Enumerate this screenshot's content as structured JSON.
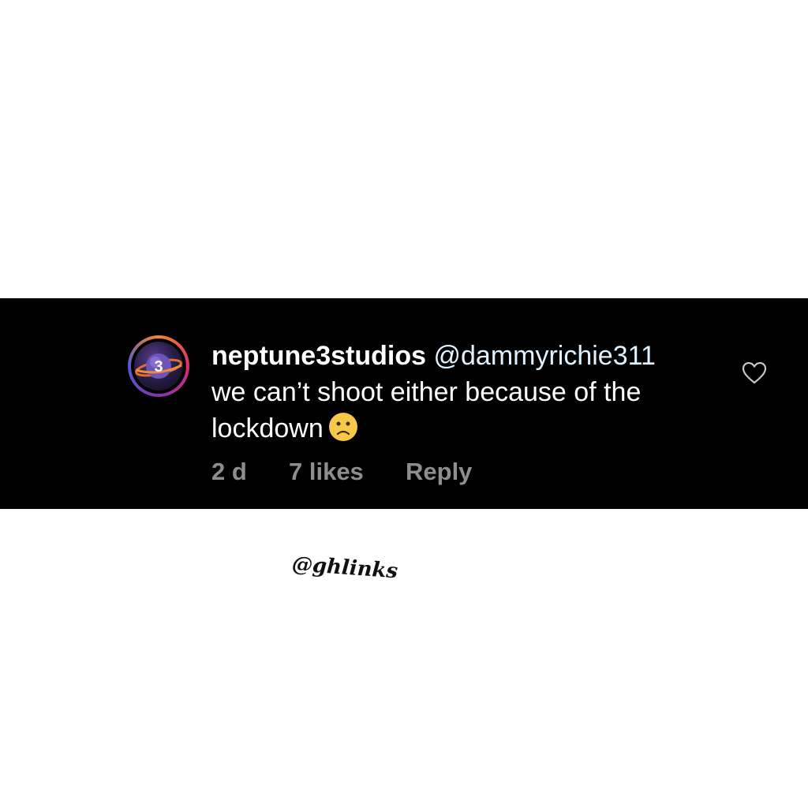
{
  "comment": {
    "username": "neptune3studios",
    "mention": "@dammyrichie311",
    "text": "we can’t shoot either because of the lockdown",
    "emoji": "slightly-frowning-face",
    "time": "2 d",
    "likes": "7 likes",
    "reply_label": "Reply",
    "avatar_label": "3"
  },
  "watermark": "@ghlinks",
  "colors": {
    "background": "#ffffff",
    "comment_band": "#000000",
    "text": "#ffffff",
    "meta": "#8e8e8e",
    "mention": "#e0f1ff",
    "emoji_face": "#f7c948"
  }
}
